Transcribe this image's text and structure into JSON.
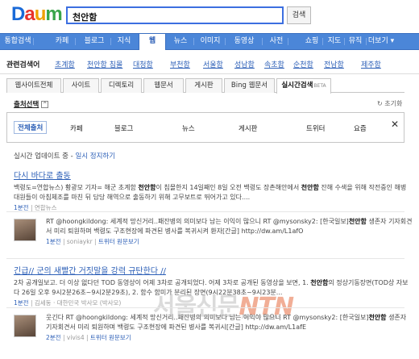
{
  "logo": "Daum",
  "search": {
    "query": "천안함",
    "button": "검색"
  },
  "nav": {
    "items": [
      "통합검색",
      "카페",
      "블로그",
      "지식",
      "웹",
      "뉴스",
      "이미지",
      "동영상",
      "사전",
      "쇼핑",
      "지도",
      "뮤직",
      "더보기 ▾"
    ],
    "active": 4
  },
  "related": {
    "label": "관련검색어",
    "items": [
      "초계함",
      "천안함 침몰",
      "대청함",
      "부천함",
      "서울함",
      "성남함",
      "속초함",
      "순천함",
      "전남함",
      "제주함"
    ]
  },
  "subtabs": {
    "items": [
      "웹사이트전체",
      "사이트",
      "디렉토리",
      "웹문서",
      "게시판",
      "Bing 웹문서",
      "실시간검색"
    ],
    "beta": "BETA",
    "active": 6
  },
  "source_select": {
    "label": "출처선택",
    "toggle": "^",
    "reset": "↻ 초기화"
  },
  "filter": {
    "items": [
      "전체출처",
      "카페",
      "블로그",
      "뉴스",
      "게시판",
      "트위터",
      "요즘"
    ],
    "active": 0,
    "close": "✕"
  },
  "live": {
    "text": "실시간 업데이트 중 -",
    "stop": "일시 정지하기"
  },
  "results": [
    {
      "type": "news",
      "title": "다시 바다로 출동",
      "snippet_pre": "백령도=연합뉴스) 황광모 기자= 해군 초계함 ",
      "snippet_bold": "천안함",
      "snippet_mid": "이 침몰한지 14일째인 8일 오전 백령도 장촌해안에서 ",
      "snippet_bold2": "천안함",
      "snippet_post": " 잔해 수색을 위해 작전중인 해병대원들이 아침체조를 마친 뒤 담당 해역으로 출동하기 위해 고무보트로 뛰어가고 있다....",
      "time": "1분전",
      "source": "연합뉴스"
    },
    {
      "type": "tweet",
      "text_pre": "RT @hoongkildong: 세계적 망신거리..패잔병의 의미보다 남는 이익이 많으니 RT @mysonsky2: [한국일보]",
      "text_bold": "천안함",
      "text_post": " 생존자 기자회견서 미리 퇴원하며 백령도 구조현장에 파견된 병사를 복귀시켜 환자[간글] http://dw.am/L1afO",
      "time": "1분전",
      "user": "soniaykr",
      "link": "트위터 원문보기"
    },
    {
      "type": "news",
      "title": "긴급// 군의 새빨간 거짓말을 강력 규탄한다 //",
      "snippet_pre": "2차 공개일보고. 더 이상 없다던 TOD 동영상이 어제 3차로 공개되었다. 어제 3차로 공개된 동영상을 보면, 1. ",
      "snippet_bold": "천안함",
      "snippet_mid": "의 정상기동장면(TOD상 자보다 26일 오후 9시2분26초~9시2분29초), 2. 함수 함미가 분리된 장면(9시22분38초~9시23분...",
      "snippet_bold2": "",
      "snippet_post": "",
      "time": "1분전",
      "source": "김세동 · 대한민국 박사모 (박사모)"
    },
    {
      "type": "tweet",
      "text_pre": "웃긴다 RT @hoongkildong: 세계적 망신거리..패잔병의 의미보다 남는 이익이 많으니 RT @mysonsky2: [한국일보]",
      "text_bold": "천안함",
      "text_post": " 생존자 기자회견서 미리 퇴원하며 백령도 구조현장에 파견된 병사를 복귀시[간글] http://dw.am/L1afE",
      "time": "2분전",
      "user": "vivis4",
      "link": "트위터 원문보기"
    }
  ],
  "watermark": {
    "main": "서울신문",
    "ntn": "NTN",
    "sub": "Net to News"
  }
}
